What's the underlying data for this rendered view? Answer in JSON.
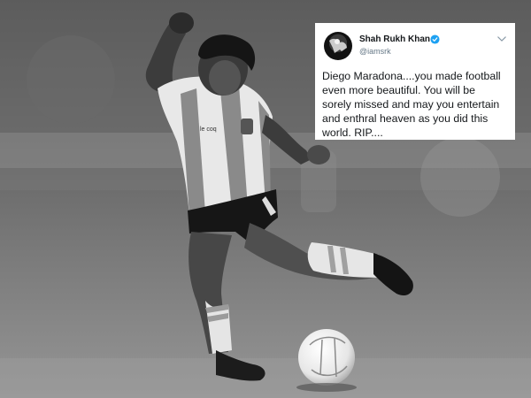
{
  "tweet": {
    "display_name": "Shah Rukh Khan",
    "handle": "@iamsrk",
    "verified": true,
    "text": "Diego Maradona....you made football\neven more beautiful. You will be\nsorely missed and may you entertain\nand enthral heaven as you did this\nworld. RIP....",
    "avatar_icon": "profile-photo",
    "menu_icon": "chevron-down-icon"
  },
  "photo": {
    "subject_icon": "footballer-kicking-ball",
    "tone": "black-and-white",
    "kit_badge": "AFA"
  }
}
